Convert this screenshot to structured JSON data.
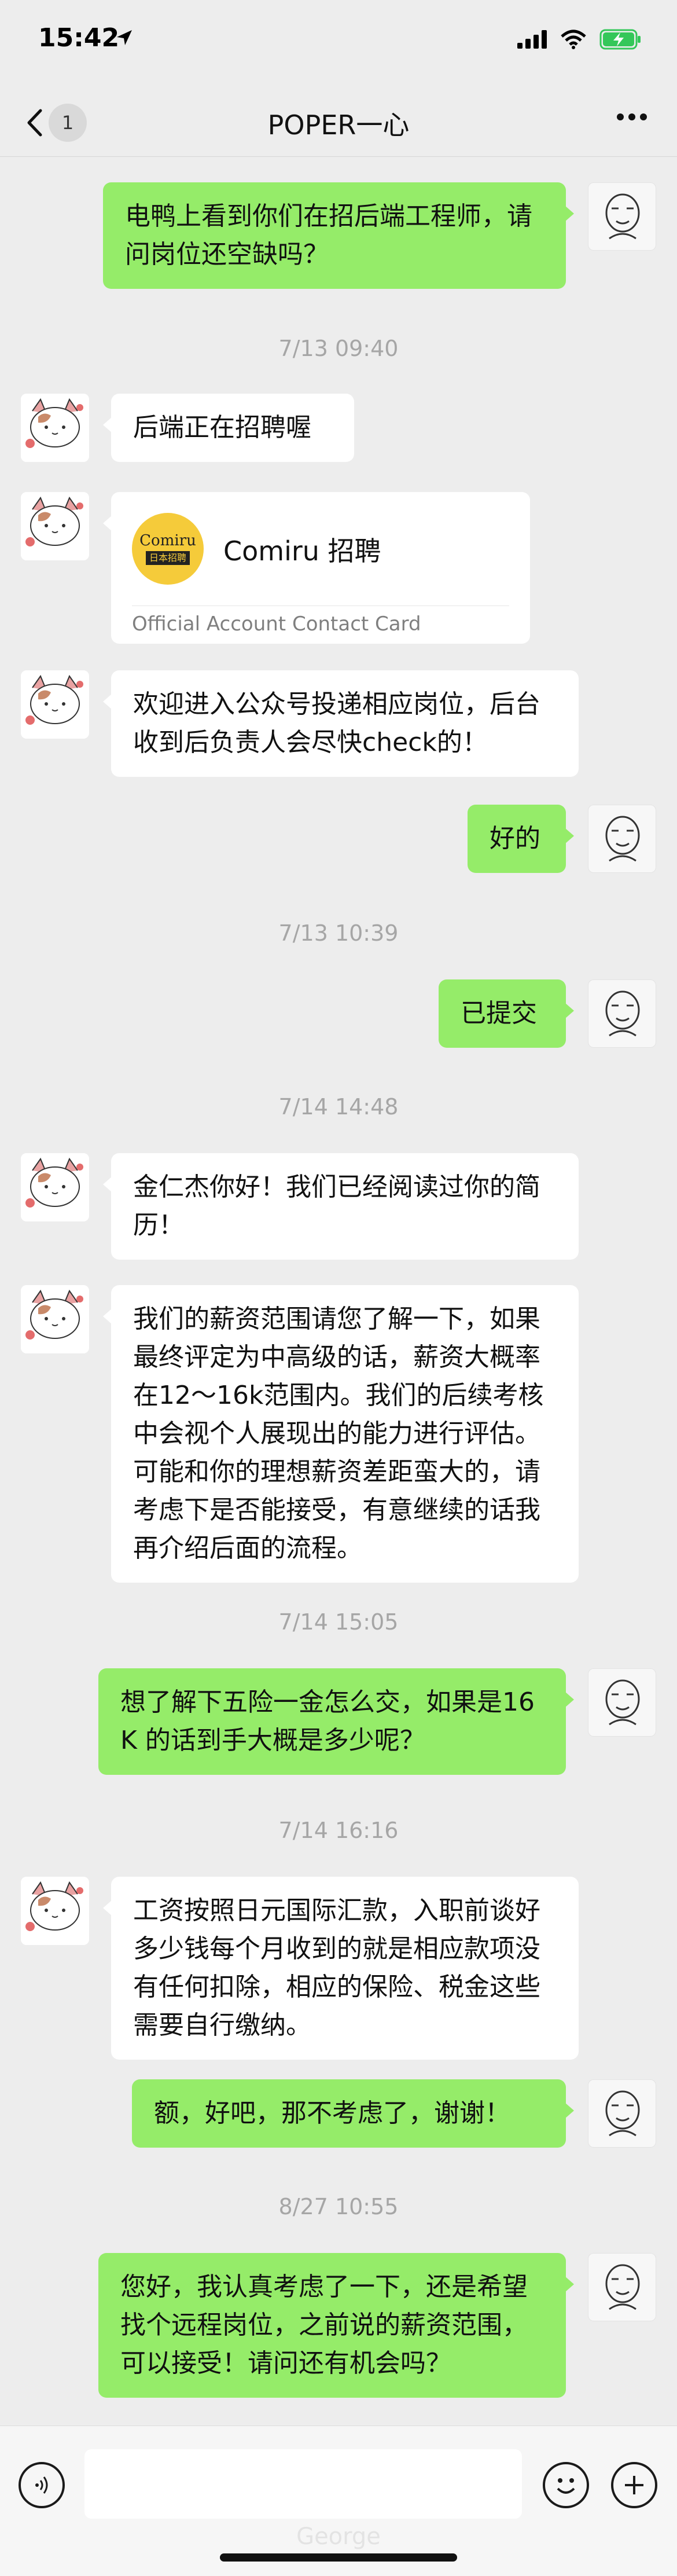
{
  "status_bar": {
    "time": "15:42",
    "icons": [
      "location-arrow-icon",
      "signal-icon",
      "wifi-icon",
      "battery-charging-icon"
    ]
  },
  "nav": {
    "unread_count": "1",
    "title": "POPER一心",
    "icons": [
      "back-chevron-icon",
      "more-icon"
    ]
  },
  "messages": [
    {
      "type": "text",
      "side": "out",
      "text": "电鸭上看到你们在招后端工程师，请问岗位还空缺吗？"
    },
    {
      "type": "time",
      "text": "7/13 09:40"
    },
    {
      "type": "text",
      "side": "in",
      "text": "后端正在招聘喔"
    },
    {
      "type": "card",
      "side": "in",
      "logo_top": "Comiru",
      "logo_bottom": "日本招聘",
      "name": "Comiru 招聘",
      "card_type": "Official Account Contact Card"
    },
    {
      "type": "text",
      "side": "in",
      "text": "欢迎进入公众号投递相应岗位，后台收到后负责人会尽快check的！"
    },
    {
      "type": "text",
      "side": "out",
      "text": "好的"
    },
    {
      "type": "time",
      "text": "7/13 10:39"
    },
    {
      "type": "text",
      "side": "out",
      "text": "已提交"
    },
    {
      "type": "time",
      "text": "7/14 14:48"
    },
    {
      "type": "text",
      "side": "in",
      "text": "金仁杰你好！我们已经阅读过你的简历！"
    },
    {
      "type": "text",
      "side": "in",
      "text": "我们的薪资范围请您了解一下，如果最终评定为中高级的话，薪资大概率在12～16k范围内。我们的后续考核中会视个人展现出的能力进行评估。可能和你的理想薪资差距蛮大的，请考虑下是否能接受，有意继续的话我再介绍后面的流程。"
    },
    {
      "type": "time",
      "text": "7/14 15:05"
    },
    {
      "type": "text",
      "side": "out",
      "text": "想了解下五险一金怎么交，如果是16K 的话到手大概是多少呢？"
    },
    {
      "type": "time",
      "text": "7/14 16:16"
    },
    {
      "type": "text",
      "side": "in",
      "text": "工资按照日元国际汇款，入职前谈好多少钱每个月收到的就是相应款项没有任何扣除，相应的保险、税金这些需要自行缴纳。"
    },
    {
      "type": "text",
      "side": "out",
      "text": "额，好吧，那不考虑了，谢谢！"
    },
    {
      "type": "time",
      "text": "8/27 10:55"
    },
    {
      "type": "text",
      "side": "out",
      "text": "您好，我认真考虑了一下，还是希望找个远程岗位，之前说的薪资范围，可以接受！请问还有机会吗？"
    }
  ],
  "input_bar": {
    "placeholder": "",
    "watermark": "George",
    "icons": [
      "voice-icon",
      "emoji-icon",
      "plus-icon"
    ]
  },
  "colors": {
    "background": "#ededed",
    "incoming_bubble": "#ffffff",
    "outgoing_bubble": "#95ec69",
    "timestamp": "#a6a6a6",
    "card_logo": "#f5cb3a"
  }
}
